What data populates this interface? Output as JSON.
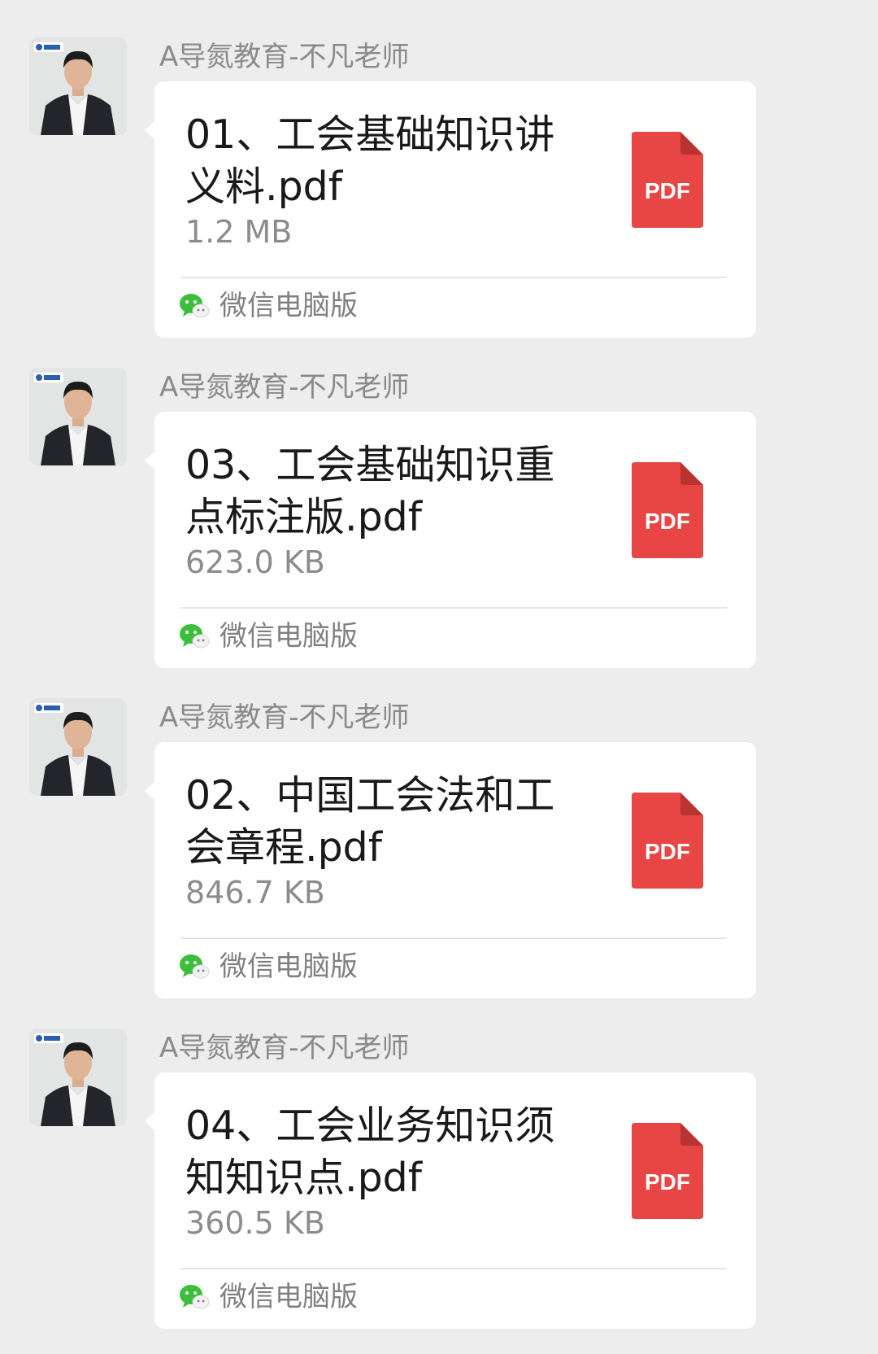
{
  "messages": [
    {
      "sender": "A导氮教育-不凡老师",
      "file_name": "01、工会基础知识讲义料.pdf",
      "file_size": "1.2 MB",
      "file_type": "PDF",
      "source": "微信电脑版"
    },
    {
      "sender": "A导氮教育-不凡老师",
      "file_name": "03、工会基础知识重点标注版.pdf",
      "file_size": "623.0 KB",
      "file_type": "PDF",
      "source": "微信电脑版"
    },
    {
      "sender": "A导氮教育-不凡老师",
      "file_name": "02、中国工会法和工会章程.pdf",
      "file_size": "846.7 KB",
      "file_type": "PDF",
      "source": "微信电脑版"
    },
    {
      "sender": "A导氮教育-不凡老师",
      "file_name": "04、工会业务知识须知知识点.pdf",
      "file_size": "360.5 KB",
      "file_type": "PDF",
      "source": "微信电脑版"
    }
  ],
  "colors": {
    "background": "#ededed",
    "bubble": "#ffffff",
    "pdf_red": "#e84545",
    "wechat_green": "#3bbf3b"
  },
  "icons": {
    "avatar": "teacher-portrait",
    "file": "pdf-file-icon",
    "source": "wechat-icon"
  }
}
